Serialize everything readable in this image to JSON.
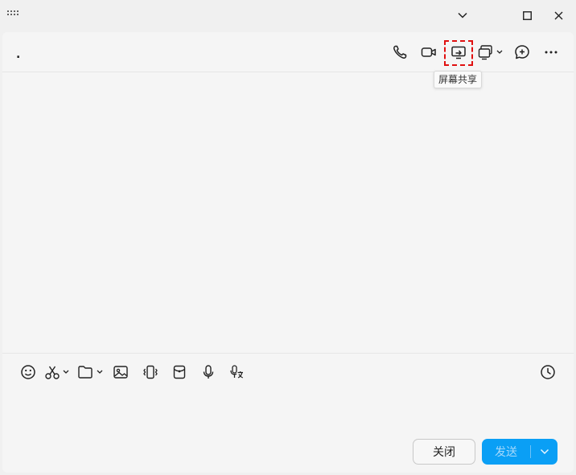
{
  "window": {
    "controls": {
      "collapse_icon": "chevron-down-icon",
      "maximize_icon": "maximize-icon",
      "close_icon": "close-icon"
    }
  },
  "chat": {
    "name": "."
  },
  "header_actions": [
    {
      "icon": "phone-icon"
    },
    {
      "icon": "video-icon"
    },
    {
      "icon": "screen-share-icon",
      "tooltip": "屏幕共享",
      "highlighted": true
    },
    {
      "icon": "remote-desktop-icon",
      "has_dropdown": true
    },
    {
      "icon": "add-chat-icon"
    },
    {
      "icon": "more-icon"
    }
  ],
  "tooltip": {
    "text": "屏幕共享"
  },
  "toolbar": [
    {
      "icon": "emoji-icon"
    },
    {
      "icon": "scissors-icon",
      "has_dropdown": true
    },
    {
      "icon": "folder-icon",
      "has_dropdown": true
    },
    {
      "icon": "image-icon"
    },
    {
      "icon": "shake-icon"
    },
    {
      "icon": "red-envelope-icon"
    },
    {
      "icon": "microphone-icon"
    },
    {
      "icon": "voice-to-text-icon"
    },
    {
      "icon": "history-clock-icon"
    }
  ],
  "footer": {
    "close_label": "关闭",
    "send_label": "发送"
  },
  "colors": {
    "accent": "#0a9ff5",
    "highlight": "#e01010",
    "background": "#f5f5f5"
  }
}
